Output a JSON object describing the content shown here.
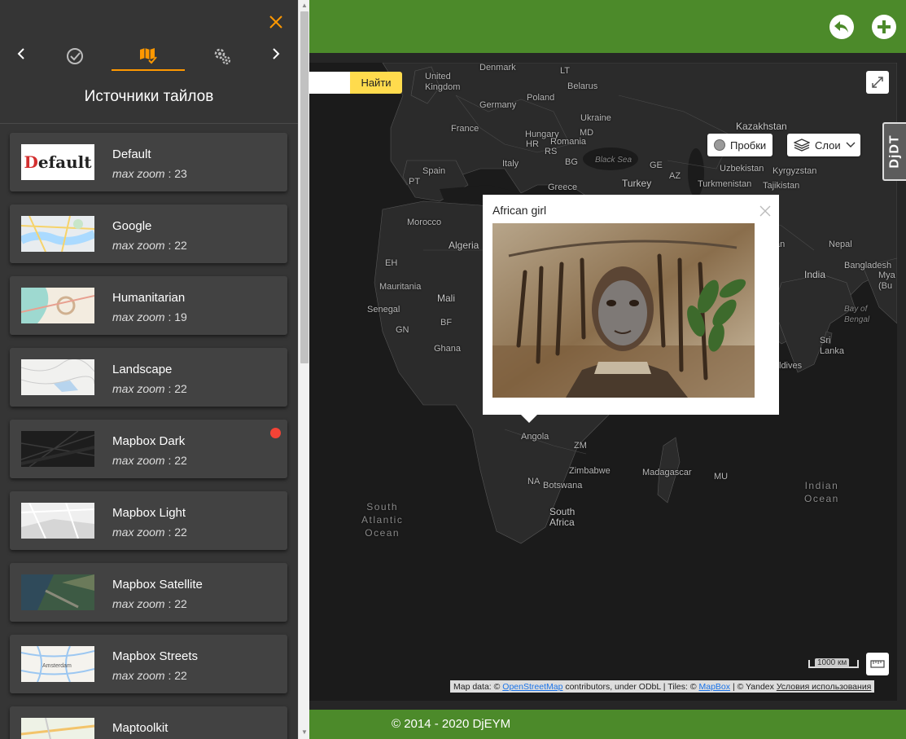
{
  "sidebar": {
    "title": "Источники тайлов",
    "zoom_label": "max zoom",
    "tabs": [
      {
        "icon": "check-circle-icon",
        "active": false
      },
      {
        "icon": "map-check-icon",
        "active": true
      },
      {
        "icon": "gears-icon",
        "active": false
      }
    ],
    "sources": [
      {
        "name": "Default",
        "zoom": ": 23",
        "thumb": "default-text-thumb",
        "badge": false,
        "thumb_text": "Default"
      },
      {
        "name": "Google",
        "zoom": ": 22",
        "thumb": "google-thumb",
        "badge": false
      },
      {
        "name": "Humanitarian",
        "zoom": ": 19",
        "thumb": "humanitarian-thumb",
        "badge": false
      },
      {
        "name": "Landscape",
        "zoom": ": 22",
        "thumb": "landscape-thumb",
        "badge": false
      },
      {
        "name": "Mapbox Dark",
        "zoom": ": 22",
        "thumb": "mapbox-dark-thumb",
        "badge": true
      },
      {
        "name": "Mapbox Light",
        "zoom": ": 22",
        "thumb": "mapbox-light-thumb",
        "badge": false
      },
      {
        "name": "Mapbox Satellite",
        "zoom": ": 22",
        "thumb": "mapbox-satellite-thumb",
        "badge": false
      },
      {
        "name": "Mapbox Streets",
        "zoom": ": 22",
        "thumb": "mapbox-streets-thumb",
        "badge": false
      },
      {
        "name": "Maptoolkit",
        "zoom": ": 22",
        "thumb": "maptoolkit-thumb",
        "badge": false
      }
    ],
    "thumb_texts": {
      "streets": "Amsterdam"
    }
  },
  "map": {
    "search_button": "Найти",
    "traffic_label": "Пробки",
    "layers_label": "Слои",
    "djdt_label": "DjDT",
    "scale_label": "1000 км",
    "popup": {
      "title": "African girl"
    },
    "attribution": {
      "prefix": "Map data: ©",
      "osm": "OpenStreetMap",
      "mid": "contributors, under ODbL | Tiles: ©",
      "mapbox": "MapBox",
      "yandex": "| © Yandex",
      "terms": "Условия использования"
    },
    "labels": [
      {
        "text": "Denmark",
        "cls": ""
      },
      {
        "text": "United\nKingdom",
        "cls": ""
      },
      {
        "text": "LT",
        "cls": ""
      },
      {
        "text": "Belarus",
        "cls": ""
      },
      {
        "text": "Poland",
        "cls": ""
      },
      {
        "text": "Germany",
        "cls": ""
      },
      {
        "text": "Ukraine",
        "cls": ""
      },
      {
        "text": "Kazakhstan",
        "cls": "big"
      },
      {
        "text": "France",
        "cls": ""
      },
      {
        "text": "MD",
        "cls": ""
      },
      {
        "text": "Hungary",
        "cls": ""
      },
      {
        "text": "HR",
        "cls": ""
      },
      {
        "text": "Romania",
        "cls": ""
      },
      {
        "text": "RS",
        "cls": ""
      },
      {
        "text": "Black Sea",
        "cls": "sea"
      },
      {
        "text": "Italy",
        "cls": ""
      },
      {
        "text": "BG",
        "cls": ""
      },
      {
        "text": "GE",
        "cls": ""
      },
      {
        "text": "Uzbekistan",
        "cls": ""
      },
      {
        "text": "Kyrgyzstan",
        "cls": ""
      },
      {
        "text": "Spain",
        "cls": ""
      },
      {
        "text": "PT",
        "cls": ""
      },
      {
        "text": "AZ",
        "cls": ""
      },
      {
        "text": "Turkey",
        "cls": "big"
      },
      {
        "text": "Turkmenistan",
        "cls": ""
      },
      {
        "text": "Tajikistan",
        "cls": ""
      },
      {
        "text": "Greece",
        "cls": ""
      },
      {
        "text": "Morocco",
        "cls": ""
      },
      {
        "text": "Algeria",
        "cls": "big"
      },
      {
        "text": "EH",
        "cls": ""
      },
      {
        "text": "Mauritania",
        "cls": ""
      },
      {
        "text": "Mali",
        "cls": "big"
      },
      {
        "text": "Senegal",
        "cls": ""
      },
      {
        "text": "BF",
        "cls": ""
      },
      {
        "text": "GN",
        "cls": ""
      },
      {
        "text": "Ghana",
        "cls": ""
      },
      {
        "text": "Nepal",
        "cls": ""
      },
      {
        "text": "Bangladesh",
        "cls": ""
      },
      {
        "text": "India",
        "cls": "big"
      },
      {
        "text": "Mya\n(Bu",
        "cls": ""
      },
      {
        "text": "Bay of\nBengal",
        "cls": "sea"
      },
      {
        "text": "Sri\nLanka",
        "cls": ""
      },
      {
        "text": "ldives",
        "cls": ""
      },
      {
        "text": "Angola",
        "cls": ""
      },
      {
        "text": "ZM",
        "cls": ""
      },
      {
        "text": "Zimbabwe",
        "cls": ""
      },
      {
        "text": "Madagascar",
        "cls": ""
      },
      {
        "text": "MU",
        "cls": ""
      },
      {
        "text": "NA",
        "cls": ""
      },
      {
        "text": "Botswana",
        "cls": ""
      },
      {
        "text": "South\nAfrica",
        "cls": "big"
      },
      {
        "text": "South\nAtlantic\nOcean",
        "cls": "ocean"
      },
      {
        "text": "Indian\nOcean",
        "cls": "ocean"
      },
      {
        "text": "an",
        "cls": ""
      }
    ]
  },
  "footer": {
    "text": "© 2014 - 2020 DjEYM"
  },
  "colors": {
    "accent": "#ff9800",
    "green": "#4c8a2a",
    "search": "#ffdb4d",
    "badge": "#f44336"
  }
}
